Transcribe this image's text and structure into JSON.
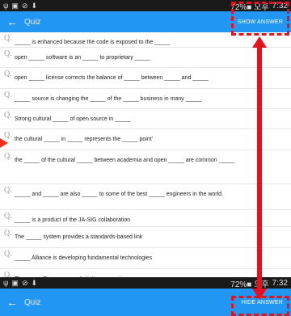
{
  "status_top": {
    "time": "7:32",
    "info": "72%■ 오후"
  },
  "status_bottom": {
    "time": "7:32",
    "info": "72%■ 오후"
  },
  "appbar_top": {
    "back": "←",
    "title": "Quiz",
    "action": "SHOW ANSWER"
  },
  "appbar_bottom": {
    "back": "←",
    "title": "Quiz",
    "action": "HIDE ANSWER"
  },
  "question_label": "Q.",
  "questions": [
    "_____ is enhanced because the code is exposed to the _____",
    "open _____ software is an _____ to proprietary _____",
    "open _____ license corrects the balance of _____ between _____ and _____",
    "_____ source is changing the _____ of the _____ business in many _____",
    "Strong cultural _____ of open source in _____",
    "the cultural _____ in _____ represents the _____ point'",
    "the _____ of the cultural _____ between academia and open _____ are common _____",
    "_____ and _____ are also _____ to some of the best _____ engineers in the world.",
    "_____ is a product of the JA-SIG collaboration",
    "The _____ system provides a standards-based link",
    "_____ Alliance is developing fundamental technologies",
    "The _____ Source _____ Initiative _____ is a _____"
  ]
}
